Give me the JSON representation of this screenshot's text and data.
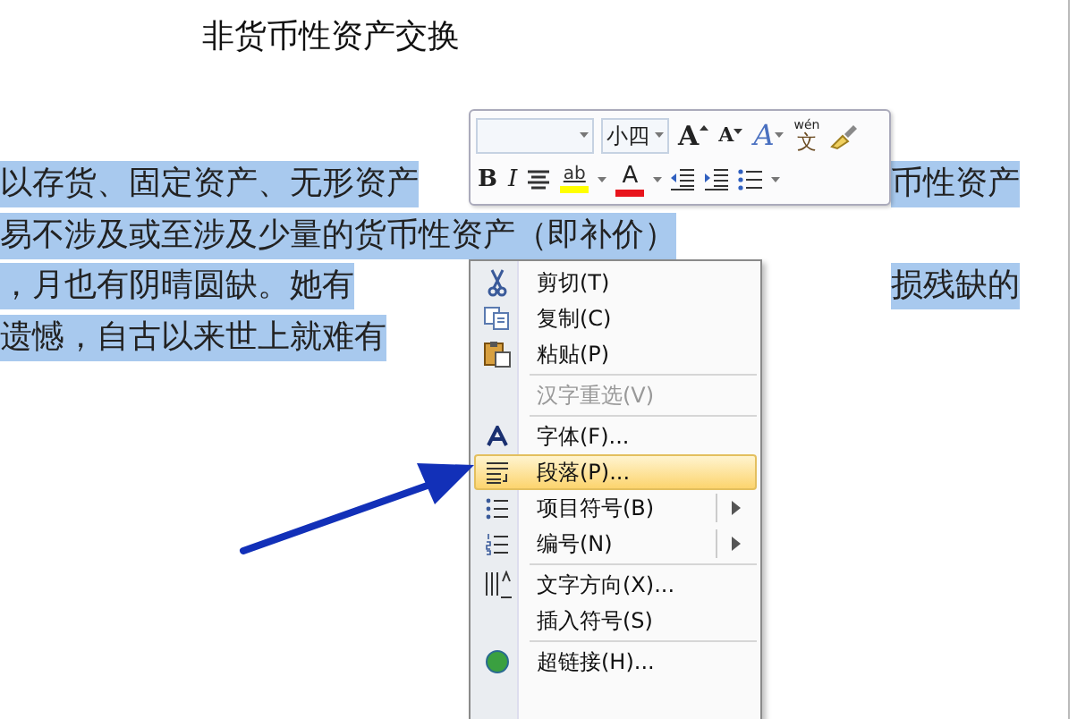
{
  "document": {
    "title": "非货币性资产交换",
    "lines": [
      {
        "left": "以存货、固定资产、无形资产",
        "right": "币性资产",
        "selected": true
      },
      {
        "left": "易不涉及或至涉及少量的货币性资产（即补价）",
        "selected": true
      },
      {
        "left": "，月也有阴晴圆缺。她有",
        "right": "损残缺的",
        "selected": true
      },
      {
        "left": "遗憾，自古以来世上就难有",
        "selected": true
      }
    ]
  },
  "mini_toolbar": {
    "font_size": "小四",
    "row_1": [
      {
        "kind": "grow",
        "label": "A"
      },
      {
        "kind": "shrink",
        "label": "A"
      },
      {
        "kind": "styles",
        "label": "A"
      },
      {
        "kind": "phonetic",
        "top": "wén",
        "bottom": "文"
      },
      {
        "kind": "painter"
      }
    ],
    "row_2": [
      {
        "kind": "bold",
        "label": "B"
      },
      {
        "kind": "italic",
        "label": "I"
      },
      {
        "kind": "center"
      },
      {
        "kind": "highlight",
        "label": "ab",
        "color": "#ffff00"
      },
      {
        "kind": "caret"
      },
      {
        "kind": "font-color",
        "label": "A",
        "color": "#e8141c"
      },
      {
        "kind": "caret"
      },
      {
        "kind": "outdent"
      },
      {
        "kind": "indent"
      },
      {
        "kind": "bullets"
      },
      {
        "kind": "caret"
      }
    ]
  },
  "context_menu": [
    {
      "kind": "cut",
      "label": "剪切(T)",
      "disabled": false,
      "selected": false
    },
    {
      "kind": "copy",
      "label": "复制(C)",
      "disabled": false,
      "selected": false
    },
    {
      "kind": "paste",
      "label": "粘贴(P)",
      "disabled": false,
      "selected": false
    },
    {
      "kind": "separator"
    },
    {
      "kind": "plain",
      "label": "汉字重选(V)",
      "disabled": true,
      "selected": false
    },
    {
      "kind": "separator"
    },
    {
      "kind": "font",
      "label": "字体(F)...",
      "disabled": false,
      "selected": false
    },
    {
      "kind": "paragraph",
      "label": "段落(P)...",
      "disabled": false,
      "selected": true
    },
    {
      "kind": "bullets",
      "label": "项目符号(B)",
      "disabled": false,
      "selected": false,
      "submenu": true
    },
    {
      "kind": "numbering",
      "label": "编号(N)",
      "disabled": false,
      "selected": false,
      "submenu": true
    },
    {
      "kind": "separator"
    },
    {
      "kind": "direction",
      "label": "文字方向(X)...",
      "disabled": false,
      "selected": false
    },
    {
      "kind": "plain",
      "label": "插入符号(S)",
      "disabled": false,
      "selected": false
    },
    {
      "kind": "separator"
    },
    {
      "kind": "hyperlink",
      "label": "超链接(H)...",
      "disabled": false,
      "selected": false
    }
  ]
}
